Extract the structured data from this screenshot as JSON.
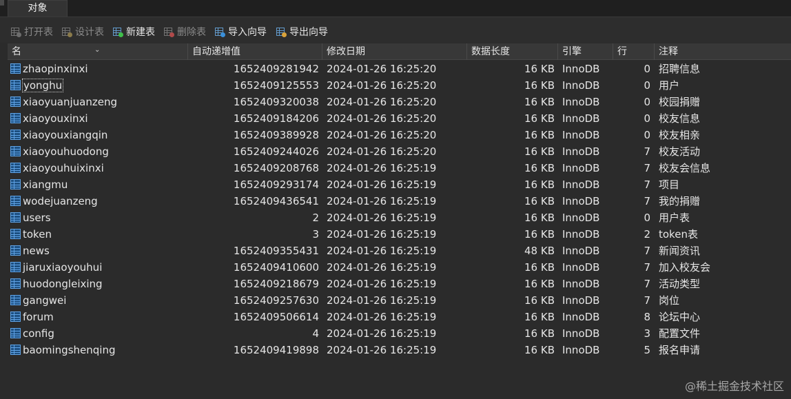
{
  "tabs": [
    {
      "label": "对象"
    }
  ],
  "toolbar": {
    "open_table": "打开表",
    "design_table": "设计表",
    "new_table": "新建表",
    "delete_table": "删除表",
    "import_wizard": "导入向导",
    "export_wizard": "导出向导"
  },
  "columns": {
    "name": "名",
    "auto_increment": "自动递增值",
    "modified": "修改日期",
    "data_length": "数据长度",
    "engine": "引擎",
    "rows": "行",
    "comment": "注释"
  },
  "tables": [
    {
      "name": "zhaopinxinxi",
      "auto_increment": "1652409281942",
      "modified": "2024-01-26 16:25:20",
      "data_length": "16 KB",
      "engine": "InnoDB",
      "rows": "0",
      "comment": "招聘信息"
    },
    {
      "name": "yonghu",
      "auto_increment": "1652409125553",
      "modified": "2024-01-26 16:25:20",
      "data_length": "16 KB",
      "engine": "InnoDB",
      "rows": "0",
      "comment": "用户"
    },
    {
      "name": "xiaoyuanjuanzeng",
      "auto_increment": "1652409320038",
      "modified": "2024-01-26 16:25:20",
      "data_length": "16 KB",
      "engine": "InnoDB",
      "rows": "0",
      "comment": "校园捐赠"
    },
    {
      "name": "xiaoyouxinxi",
      "auto_increment": "1652409184206",
      "modified": "2024-01-26 16:25:20",
      "data_length": "16 KB",
      "engine": "InnoDB",
      "rows": "0",
      "comment": "校友信息"
    },
    {
      "name": "xiaoyouxiangqin",
      "auto_increment": "1652409389928",
      "modified": "2024-01-26 16:25:20",
      "data_length": "16 KB",
      "engine": "InnoDB",
      "rows": "0",
      "comment": "校友相亲"
    },
    {
      "name": "xiaoyouhuodong",
      "auto_increment": "1652409244026",
      "modified": "2024-01-26 16:25:20",
      "data_length": "16 KB",
      "engine": "InnoDB",
      "rows": "7",
      "comment": "校友活动"
    },
    {
      "name": "xiaoyouhuixinxi",
      "auto_increment": "1652409208768",
      "modified": "2024-01-26 16:25:19",
      "data_length": "16 KB",
      "engine": "InnoDB",
      "rows": "7",
      "comment": "校友会信息"
    },
    {
      "name": "xiangmu",
      "auto_increment": "1652409293174",
      "modified": "2024-01-26 16:25:19",
      "data_length": "16 KB",
      "engine": "InnoDB",
      "rows": "7",
      "comment": "项目"
    },
    {
      "name": "wodejuanzeng",
      "auto_increment": "1652409436541",
      "modified": "2024-01-26 16:25:19",
      "data_length": "16 KB",
      "engine": "InnoDB",
      "rows": "7",
      "comment": "我的捐赠"
    },
    {
      "name": "users",
      "auto_increment": "2",
      "modified": "2024-01-26 16:25:19",
      "data_length": "16 KB",
      "engine": "InnoDB",
      "rows": "0",
      "comment": "用户表"
    },
    {
      "name": "token",
      "auto_increment": "3",
      "modified": "2024-01-26 16:25:19",
      "data_length": "16 KB",
      "engine": "InnoDB",
      "rows": "2",
      "comment": "token表"
    },
    {
      "name": "news",
      "auto_increment": "1652409355431",
      "modified": "2024-01-26 16:25:19",
      "data_length": "48 KB",
      "engine": "InnoDB",
      "rows": "7",
      "comment": "新闻资讯"
    },
    {
      "name": "jiaruxiaoyouhui",
      "auto_increment": "1652409410600",
      "modified": "2024-01-26 16:25:19",
      "data_length": "16 KB",
      "engine": "InnoDB",
      "rows": "7",
      "comment": "加入校友会"
    },
    {
      "name": "huodongleixing",
      "auto_increment": "1652409218679",
      "modified": "2024-01-26 16:25:19",
      "data_length": "16 KB",
      "engine": "InnoDB",
      "rows": "7",
      "comment": "活动类型"
    },
    {
      "name": "gangwei",
      "auto_increment": "1652409257630",
      "modified": "2024-01-26 16:25:19",
      "data_length": "16 KB",
      "engine": "InnoDB",
      "rows": "7",
      "comment": "岗位"
    },
    {
      "name": "forum",
      "auto_increment": "1652409506614",
      "modified": "2024-01-26 16:25:19",
      "data_length": "16 KB",
      "engine": "InnoDB",
      "rows": "8",
      "comment": "论坛中心"
    },
    {
      "name": "config",
      "auto_increment": "4",
      "modified": "2024-01-26 16:25:19",
      "data_length": "16 KB",
      "engine": "InnoDB",
      "rows": "3",
      "comment": "配置文件"
    },
    {
      "name": "baomingshenqing",
      "auto_increment": "1652409419898",
      "modified": "2024-01-26 16:25:19",
      "data_length": "16 KB",
      "engine": "InnoDB",
      "rows": "5",
      "comment": "报名申请"
    }
  ],
  "focused_table": "yonghu",
  "watermark": "@稀土掘金技术社区"
}
